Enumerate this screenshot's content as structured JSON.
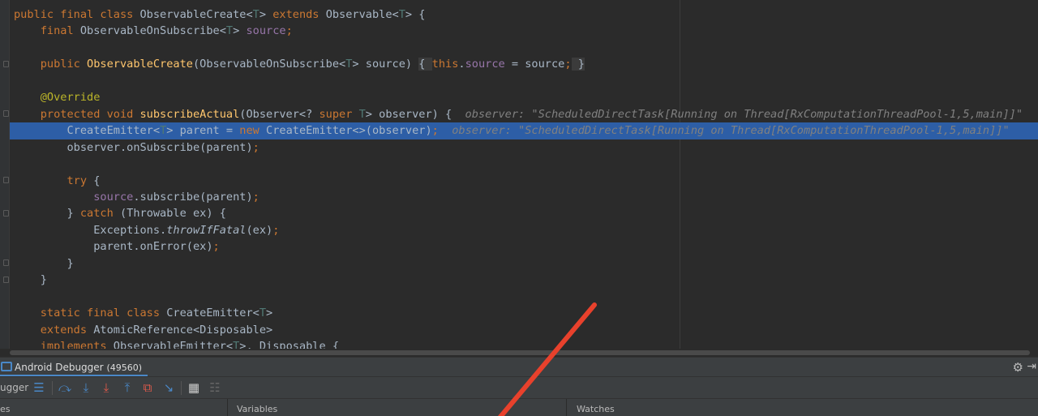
{
  "code": {
    "lines": [
      [
        [
          "public final class ",
          "kw"
        ],
        [
          "ObservableCreate<",
          ""
        ],
        [
          "T",
          "tp"
        ],
        [
          "> ",
          ""
        ],
        [
          "extends ",
          "kw"
        ],
        [
          "Observable<",
          ""
        ],
        [
          "T",
          "tp"
        ],
        [
          "> {",
          ""
        ]
      ],
      [
        [
          "    final ",
          "kw"
        ],
        [
          "ObservableOnSubscribe<",
          ""
        ],
        [
          "T",
          "tp"
        ],
        [
          "> ",
          ""
        ],
        [
          "source",
          "fld"
        ],
        [
          ";",
          "kw"
        ]
      ],
      [],
      [
        [
          "    public ",
          "kw"
        ],
        [
          "ObservableCreate",
          "fn"
        ],
        [
          "(ObservableOnSubscribe<",
          ""
        ],
        [
          "T",
          "tp"
        ],
        [
          "> source) ",
          ""
        ],
        [
          "{ ",
          "brace"
        ],
        [
          "this",
          "kw"
        ],
        [
          ".",
          ""
        ],
        [
          "source",
          "fld"
        ],
        [
          " = source",
          ""
        ],
        [
          ";",
          "kw"
        ],
        [
          " }",
          "brace"
        ]
      ],
      [],
      [
        [
          "    @Override",
          "ann"
        ]
      ],
      [
        [
          "    protected void ",
          "kw"
        ],
        [
          "subscribeActual",
          "fn"
        ],
        [
          "(Observer<? ",
          ""
        ],
        [
          "super ",
          "kw"
        ],
        [
          "T",
          "tp"
        ],
        [
          "> observer) {  ",
          ""
        ],
        [
          "observer: \"ScheduledDirectTask[Running on Thread[RxComputationThreadPool-1,5,main]]\"",
          "hint"
        ]
      ],
      [
        [
          "        CreateEmitter<",
          ""
        ],
        [
          "T",
          "tp"
        ],
        [
          "> parent = ",
          ""
        ],
        [
          "new ",
          "kw"
        ],
        [
          "CreateEmitter<>(observer)",
          ""
        ],
        [
          ";",
          "kw"
        ],
        [
          "  observer: \"ScheduledDirectTask[Running on Thread[RxComputationThreadPool-1,5,main]]\"",
          "hint"
        ]
      ],
      [
        [
          "        observer.onSubscribe(parent)",
          ""
        ],
        [
          ";",
          "kw"
        ]
      ],
      [],
      [
        [
          "        try ",
          "kw"
        ],
        [
          "{",
          ""
        ]
      ],
      [
        [
          "            source",
          "fld"
        ],
        [
          ".subscribe(parent)",
          ""
        ],
        [
          ";",
          "kw"
        ]
      ],
      [
        [
          "        } ",
          ""
        ],
        [
          "catch ",
          "kw"
        ],
        [
          "(Throwable ex) {",
          ""
        ]
      ],
      [
        [
          "            Exceptions.",
          ""
        ],
        [
          "throwIfFatal",
          "it"
        ],
        [
          "(ex)",
          ""
        ],
        [
          ";",
          "kw"
        ]
      ],
      [
        [
          "            parent.onError(ex)",
          ""
        ],
        [
          ";",
          "kw"
        ]
      ],
      [
        [
          "        }",
          ""
        ]
      ],
      [
        [
          "    }",
          ""
        ]
      ],
      [],
      [
        [
          "    static final class ",
          "kw"
        ],
        [
          "CreateEmitter<",
          ""
        ],
        [
          "T",
          "tp"
        ],
        [
          ">",
          ""
        ]
      ],
      [
        [
          "    extends ",
          "kw"
        ],
        [
          "AtomicReference<Disposable>",
          ""
        ]
      ],
      [
        [
          "    implements ",
          "kw"
        ],
        [
          "ObservableEmitter<",
          ""
        ],
        [
          "T",
          "tp"
        ],
        [
          ">, Disposable {",
          ""
        ]
      ]
    ]
  },
  "debugger": {
    "tab_label": "Android Debugger",
    "pid": "(49560)",
    "toolbar_label": "ugger",
    "gear_icon": "gear-icon",
    "frames_header": "es",
    "variables_header": "Variables",
    "watches_header": "Watches"
  },
  "colors": {
    "highlight": "#2d5ea6",
    "arrow": "#e8412c"
  }
}
